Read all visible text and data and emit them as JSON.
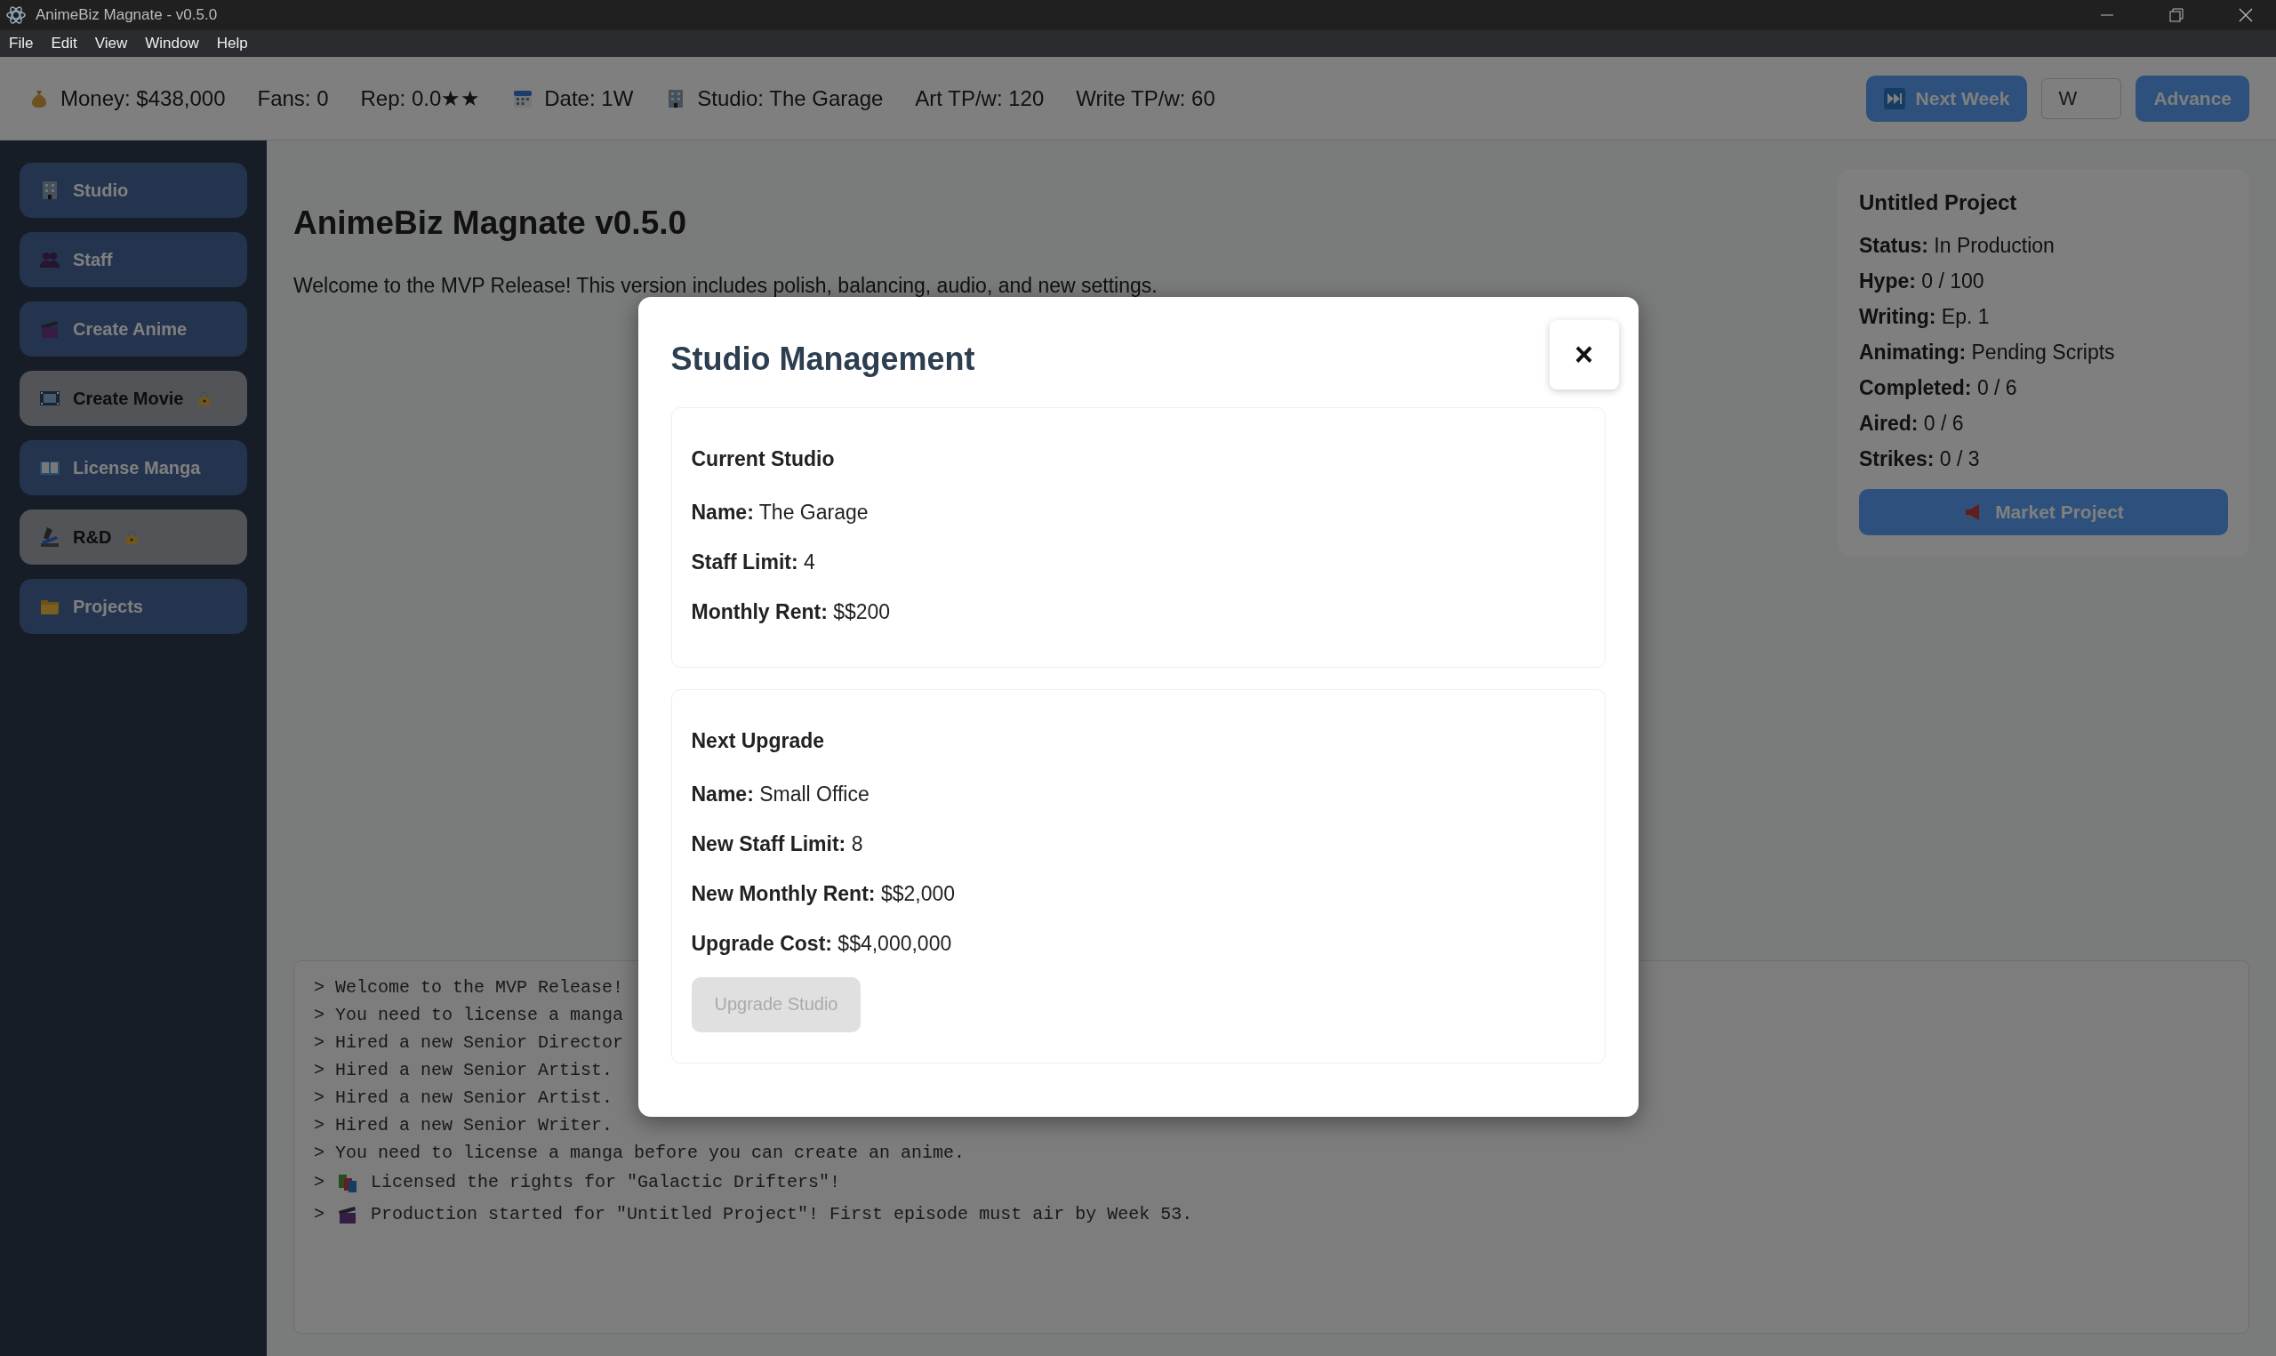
{
  "window": {
    "title": "AnimeBiz Magnate - v0.5.0"
  },
  "menu": [
    "File",
    "Edit",
    "View",
    "Window",
    "Help"
  ],
  "stats": [
    {
      "kind": "money",
      "text": "Money: $438,000"
    },
    {
      "kind": "plain",
      "text": "Fans: 0"
    },
    {
      "kind": "plain",
      "text": "Rep: 0.0★★"
    },
    {
      "kind": "calendar",
      "text": "Date: 1W"
    },
    {
      "kind": "building",
      "text": "Studio: The Garage"
    },
    {
      "kind": "plain",
      "text": "Art TP/w: 120"
    },
    {
      "kind": "plain",
      "text": "Write TP/w: 60"
    }
  ],
  "controls": {
    "next_button": "Next Week",
    "weeks_field": {
      "placeholder": "W"
    },
    "advance_button": "Advance"
  },
  "sidebar": {
    "items": [
      {
        "kind": "studio",
        "label": "Studio",
        "locked": false
      },
      {
        "kind": "staff",
        "label": "Staff",
        "locked": false
      },
      {
        "kind": "anime",
        "label": "Create Anime",
        "locked": false
      },
      {
        "kind": "movie",
        "label": "Create Movie",
        "locked": true
      },
      {
        "kind": "manga",
        "label": "License Manga",
        "locked": false
      },
      {
        "kind": "research",
        "label": "R&D",
        "locked": true
      },
      {
        "kind": "projects",
        "label": "Projects",
        "locked": false
      }
    ]
  },
  "main": {
    "heading": "AnimeBiz Magnate v0.5.0",
    "intro": "Welcome to the MVP Release! This version includes polish, balancing, audio, and new settings."
  },
  "project_panel": {
    "title": "Untitled Project",
    "fields": [
      "**Status:** In Production",
      "**Hype:** 0 / 100",
      "**Writing:** Ep. 1",
      "**Animating:** Pending Scripts",
      "**Completed:** 0 / 6",
      "**Aired:** 0 / 6",
      "**Strikes:** 0 / 3"
    ],
    "button": "Market Project"
  },
  "log": [
    {
      "kind": "plain",
      "text": "> Welcome to the MVP Release!"
    },
    {
      "kind": "plain",
      "text": "> You need to license a manga"
    },
    {
      "kind": "plain",
      "text": "> Hired a new Senior Director"
    },
    {
      "kind": "plain",
      "text": "> Hired a new Senior Artist."
    },
    {
      "kind": "plain",
      "text": "> Hired a new Senior Artist."
    },
    {
      "kind": "plain",
      "text": "> Hired a new Senior Writer."
    },
    {
      "kind": "plain",
      "text": "> You need to license a manga before you can create an anime."
    },
    {
      "kind": "books",
      "prompt": ">",
      "text": "Licensed the rights for \"Galactic Drifters\"!"
    },
    {
      "kind": "clapper",
      "prompt": ">",
      "text": "Production started for \"Untitled Project\"! First episode must air by Week 53."
    }
  ],
  "modal": {
    "title": "Studio Management",
    "close": "×",
    "sections": [
      {
        "heading": "Current Studio",
        "fields": [
          "**Name:** The Garage",
          "**Staff Limit:** 4",
          "**Monthly Rent:** $$200"
        ]
      },
      {
        "heading": "Next Upgrade",
        "fields": [
          "**Name:** Small Office",
          "**New Staff Limit:** 8",
          "**New Monthly Rent:** $$2,000",
          "**Upgrade Cost:** $$4,000,000"
        ],
        "button": {
          "label": "Upgrade Studio",
          "disabled": true
        }
      }
    ]
  }
}
